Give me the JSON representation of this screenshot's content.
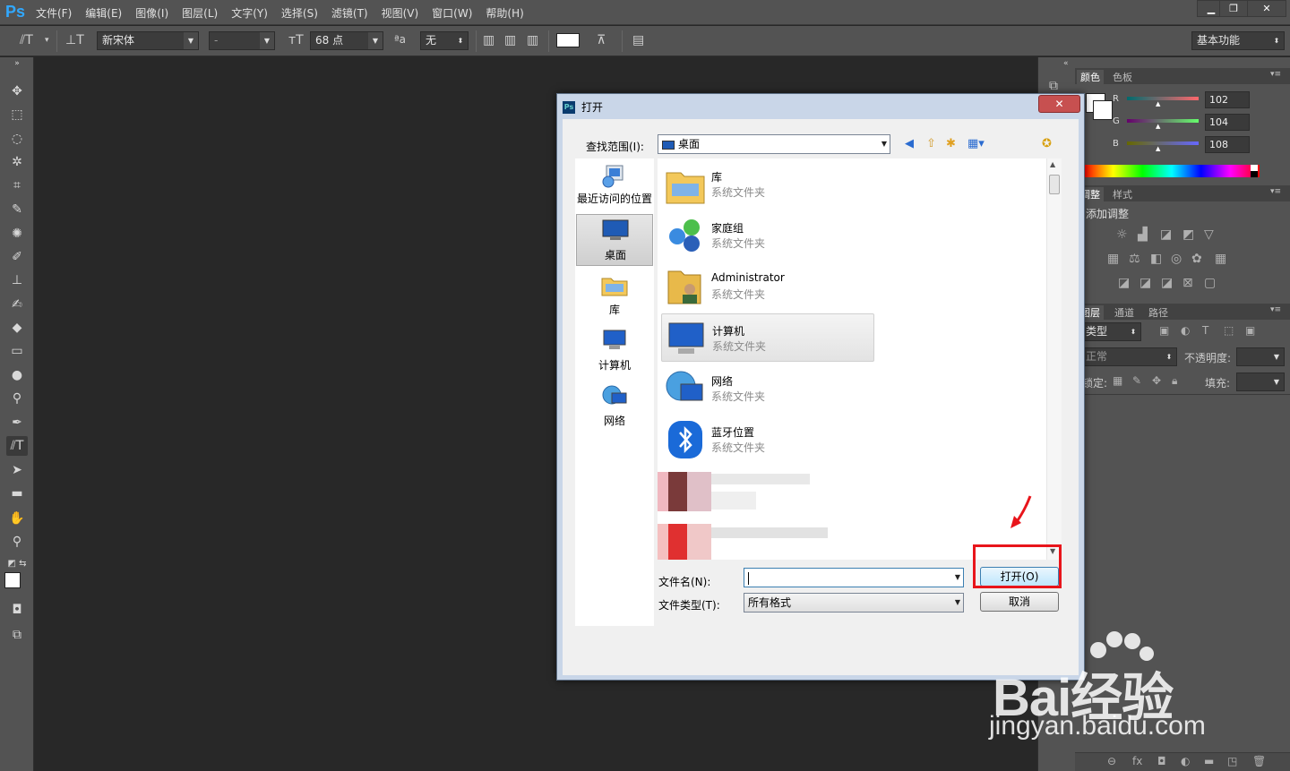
{
  "app": {
    "logo": "Ps"
  },
  "menu": [
    "文件(F)",
    "编辑(E)",
    "图像(I)",
    "图层(L)",
    "文字(Y)",
    "选择(S)",
    "滤镜(T)",
    "视图(V)",
    "窗口(W)",
    "帮助(H)"
  ],
  "window_buttons": {
    "minimize": "▁",
    "restore": "❐",
    "close": "✕"
  },
  "options": {
    "tool_icon": "⫽T",
    "font_family": "新宋体",
    "font_style": "-",
    "font_size": "68 点",
    "aa_label": "ªa",
    "antialias": "无",
    "workspace": "基本功能"
  },
  "color_panel": {
    "tabs": [
      "颜色",
      "色板"
    ],
    "channels": [
      {
        "label": "R",
        "value": "102"
      },
      {
        "label": "G",
        "value": "104"
      },
      {
        "label": "B",
        "value": "108"
      }
    ]
  },
  "adjust_panel": {
    "tabs": [
      "调整",
      "样式"
    ],
    "title": "添加调整"
  },
  "layers_panel": {
    "tabs": [
      "图层",
      "通道",
      "路径"
    ],
    "filter": "类型",
    "blend": "正常",
    "opacity_label": "不透明度:",
    "lock_label": "锁定:",
    "fill_label": "填充:"
  },
  "dialog": {
    "title": "打开",
    "icon": "Ps",
    "close": "✕",
    "lookin_label": "查找范围(I):",
    "lookin_value": "桌面",
    "places": [
      {
        "label": "最近访问的位置",
        "icon": "recent-places-icon"
      },
      {
        "label": "桌面",
        "icon": "desktop-icon"
      },
      {
        "label": "库",
        "icon": "libraries-icon"
      },
      {
        "label": "计算机",
        "icon": "computer-icon"
      },
      {
        "label": "网络",
        "icon": "network-icon"
      }
    ],
    "files": [
      {
        "name": "库",
        "type": "系统文件夹"
      },
      {
        "name": "家庭组",
        "type": "系统文件夹"
      },
      {
        "name": "Administrator",
        "type": "系统文件夹"
      },
      {
        "name": "计算机",
        "type": "系统文件夹"
      },
      {
        "name": "网络",
        "type": "系统文件夹"
      },
      {
        "name": "蓝牙位置",
        "type": "系统文件夹"
      }
    ],
    "filename_label": "文件名(N):",
    "filename_value": "",
    "filetype_label": "文件类型(T):",
    "filetype_value": "所有格式",
    "open_button": "打开(O)",
    "cancel_button": "取消"
  },
  "colors": {
    "accent": "#31a8ff",
    "highlight": "#e8151b"
  },
  "watermark": {
    "brand": "Bai经验",
    "site": "jingyan.baidu.com"
  }
}
